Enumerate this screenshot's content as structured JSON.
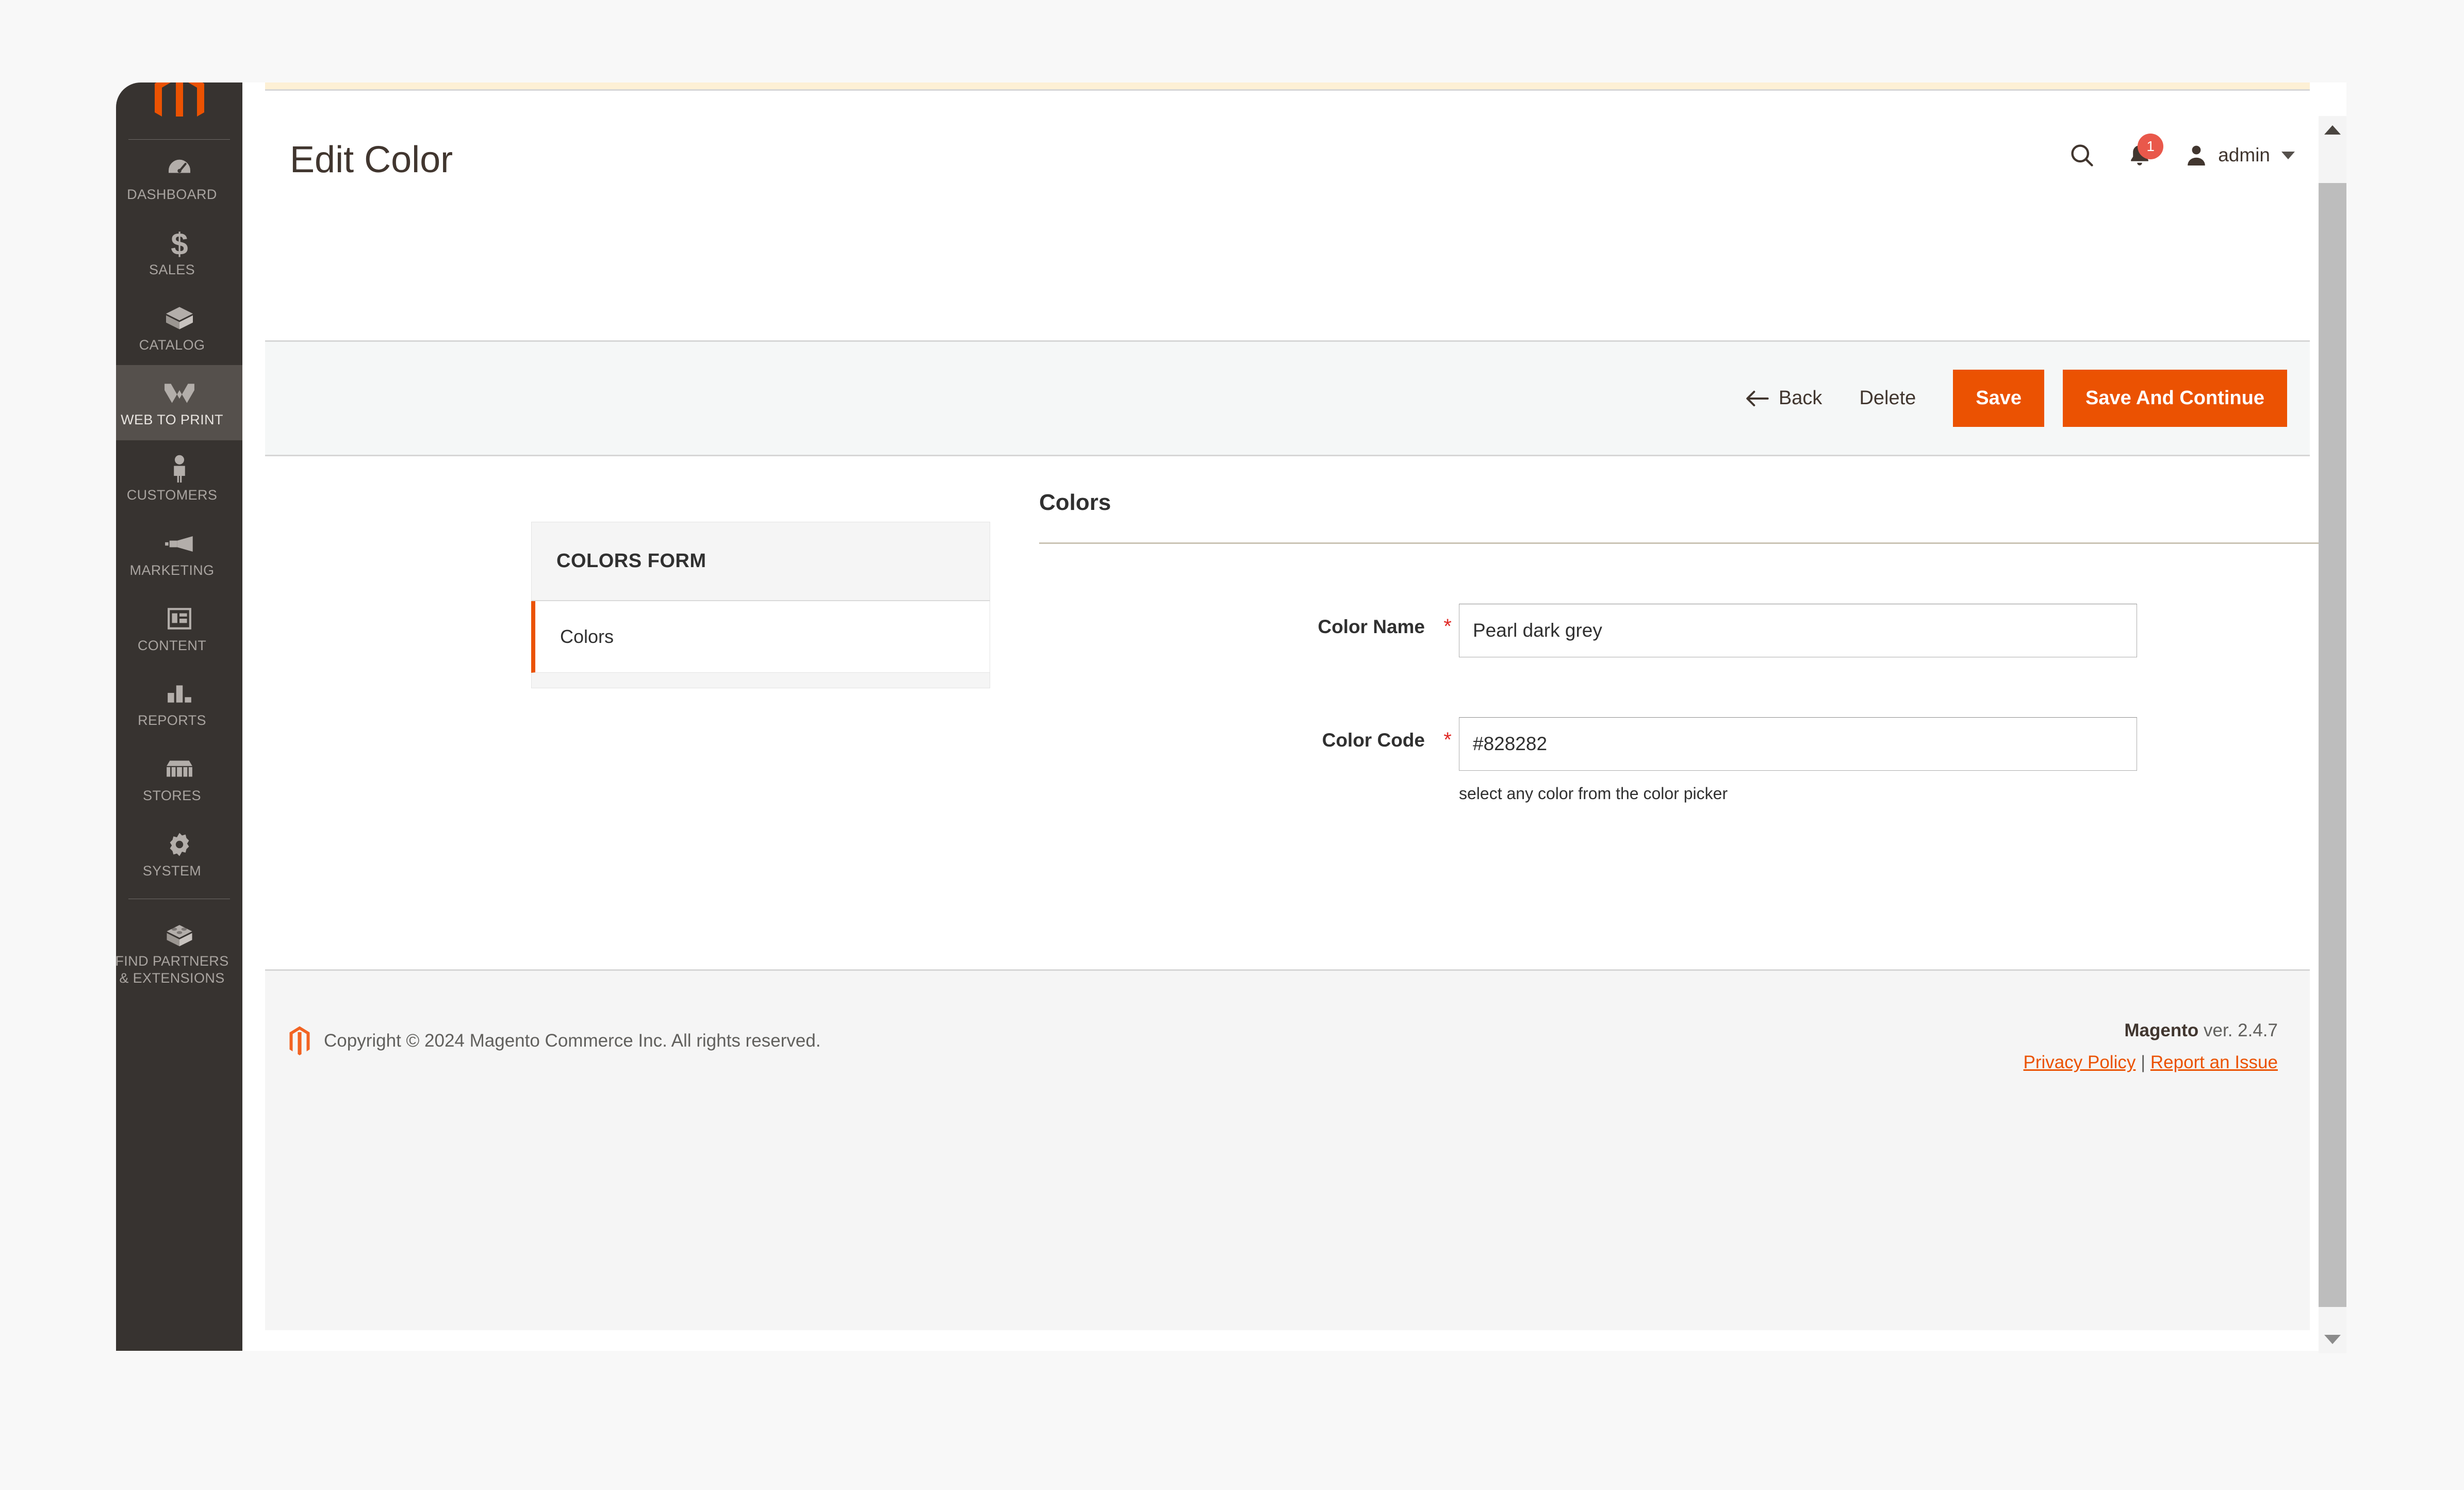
{
  "colors": {
    "accent": "#eb5202",
    "sidebar_bg": "#373330",
    "sidebar_active_bg": "#55504c",
    "badge_red": "#e9584b",
    "required_star": "#e02b27",
    "link": "#eb5202",
    "notice_bar": "#fdf0d5"
  },
  "sidebar": {
    "items": [
      {
        "label": "DASHBOARD",
        "icon": "dashboard-gauge-icon",
        "active": false
      },
      {
        "label": "SALES",
        "icon": "dollar-sign-icon",
        "active": false
      },
      {
        "label": "CATALOG",
        "icon": "box-icon",
        "active": false
      },
      {
        "label": "WEB TO PRINT",
        "icon": "w-logo-icon",
        "active": true
      },
      {
        "label": "CUSTOMERS",
        "icon": "person-icon",
        "active": false
      },
      {
        "label": "MARKETING",
        "icon": "megaphone-icon",
        "active": false
      },
      {
        "label": "CONTENT",
        "icon": "layout-page-icon",
        "active": false
      },
      {
        "label": "REPORTS",
        "icon": "bar-chart-icon",
        "active": false
      },
      {
        "label": "STORES",
        "icon": "storefront-icon",
        "active": false
      },
      {
        "label": "SYSTEM",
        "icon": "gear-icon",
        "active": false
      },
      {
        "label": "FIND PARTNERS\n& EXTENSIONS",
        "icon": "puzzle-cube-icon",
        "active": false
      }
    ]
  },
  "header": {
    "title": "Edit Color",
    "search_icon": "search-icon",
    "notifications_icon": "bell-icon",
    "notifications_count": "1",
    "user_icon": "user-avatar-icon",
    "user_name": "admin"
  },
  "toolbar": {
    "back_label": "Back",
    "back_icon": "arrow-left-icon",
    "delete_label": "Delete",
    "save_label": "Save",
    "save_continue_label": "Save And Continue"
  },
  "form_nav": {
    "title": "COLORS FORM",
    "items": [
      {
        "label": "Colors",
        "active": true
      }
    ]
  },
  "form": {
    "section_title": "Colors",
    "fields": [
      {
        "label": "Color Name",
        "required": true,
        "value": "Pearl dark grey",
        "placeholder": "",
        "note": ""
      },
      {
        "label": "Color Code",
        "required": true,
        "value": "#828282",
        "placeholder": "",
        "note": "select any color from the color picker"
      }
    ]
  },
  "footer": {
    "copyright": "Copyright © 2024 Magento Commerce Inc. All rights reserved.",
    "brand": "Magento",
    "version": " ver. 2.4.7",
    "privacy_label": "Privacy Policy",
    "separator": "|",
    "report_label": "Report an Issue",
    "logo_icon": "magento-logo-icon"
  }
}
